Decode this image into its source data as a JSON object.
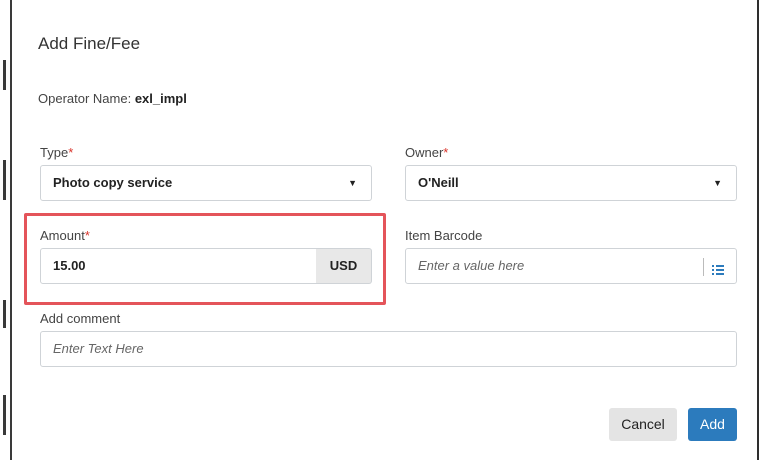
{
  "dialog": {
    "title": "Add Fine/Fee"
  },
  "operator": {
    "label": "Operator Name:",
    "value": "exl_impl"
  },
  "type": {
    "label": "Type",
    "required_mark": "*",
    "value": "Photo copy service"
  },
  "owner": {
    "label": "Owner",
    "required_mark": "*",
    "value": "O'Neill"
  },
  "amount": {
    "label": "Amount",
    "required_mark": "*",
    "value": "15.00",
    "currency": "USD"
  },
  "item_barcode": {
    "label": "Item Barcode",
    "placeholder": "Enter a value here"
  },
  "comment": {
    "label": "Add comment",
    "placeholder": "Enter Text Here"
  },
  "buttons": {
    "cancel": "Cancel",
    "add": "Add"
  },
  "colors": {
    "accent": "#2c7bbd",
    "required": "#d9342b",
    "highlight": "#e4545a"
  }
}
